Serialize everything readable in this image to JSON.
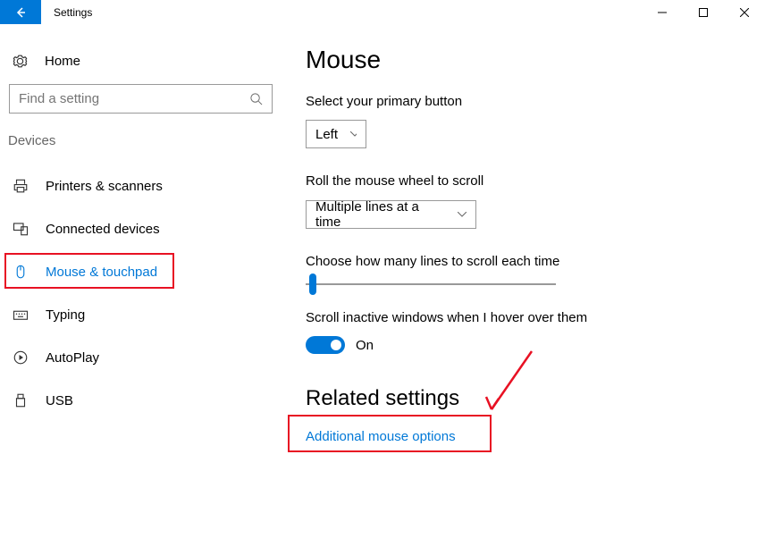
{
  "window": {
    "title": "Settings"
  },
  "sidebar": {
    "home": "Home",
    "search_placeholder": "Find a setting",
    "section": "Devices",
    "items": [
      {
        "label": "Printers & scanners"
      },
      {
        "label": "Connected devices"
      },
      {
        "label": "Mouse & touchpad"
      },
      {
        "label": "Typing"
      },
      {
        "label": "AutoPlay"
      },
      {
        "label": "USB"
      }
    ]
  },
  "main": {
    "title": "Mouse",
    "primary_button": {
      "label": "Select your primary button",
      "value": "Left"
    },
    "wheel": {
      "label": "Roll the mouse wheel to scroll",
      "value": "Multiple lines at a time"
    },
    "lines": {
      "label": "Choose how many lines to scroll each time"
    },
    "inactive": {
      "label": "Scroll inactive windows when I hover over them",
      "state": "On"
    },
    "related": {
      "title": "Related settings",
      "link": "Additional mouse options"
    }
  }
}
